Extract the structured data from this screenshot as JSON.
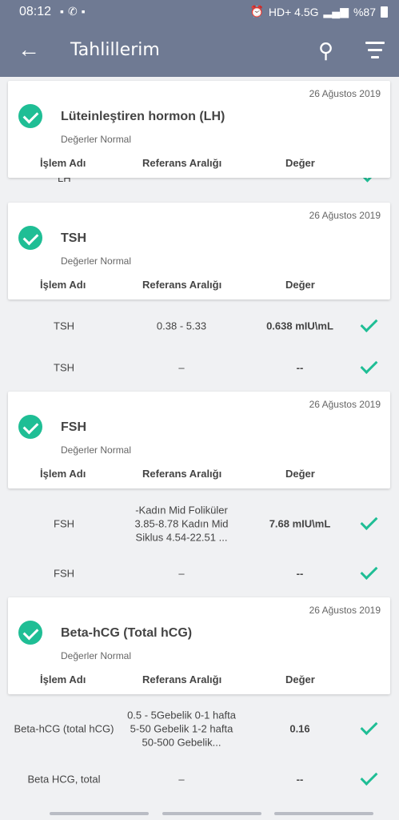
{
  "status_bar": {
    "time": "08:12",
    "network": "HD+ 4.5G",
    "battery": "%87"
  },
  "app_bar": {
    "title": "Tahlillerim"
  },
  "columns": {
    "name": "İşlem Adı",
    "range": "Referans Aralığı",
    "value": "Değer"
  },
  "partial_row": {
    "name": "LH"
  },
  "cards": [
    {
      "date": "26 Ağustos 2019",
      "name": "Lüteinleştiren hormon (LH)",
      "status": "Değerler Normal"
    },
    {
      "date": "26 Ağustos 2019",
      "name": "TSH",
      "status": "Değerler Normal"
    },
    {
      "date": "26 Ağustos 2019",
      "name": "FSH",
      "status": "Değerler Normal"
    },
    {
      "date": "26 Ağustos 2019",
      "name": "Beta-hCG (Total hCG)",
      "status": "Değerler Normal"
    }
  ],
  "rows": [
    {
      "name": "TSH",
      "range": "0.38 - 5.33",
      "value": "0.638 mIU\\mL"
    },
    {
      "name": "TSH",
      "range": "–",
      "value": "--"
    },
    {
      "name": "FSH",
      "range": "-Kadın Mid Foliküler 3.85-8.78 Kadın Mid Siklus 4.54-22.51 ...",
      "value": "7.68 mIU\\mL"
    },
    {
      "name": "FSH",
      "range": "–",
      "value": "--"
    },
    {
      "name": "Beta-hCG (total hCG)",
      "range": "0.5 - 5Gebelik 0-1 hafta 5-50 Gebelik 1-2 hafta 50-500 Gebelik...",
      "value": "0.16"
    },
    {
      "name": "Beta HCG, total",
      "range": "–",
      "value": "--"
    }
  ]
}
